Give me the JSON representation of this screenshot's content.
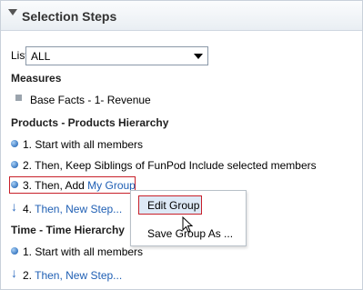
{
  "panel": {
    "title": "Selection Steps"
  },
  "list": {
    "label": "List",
    "value": "ALL"
  },
  "measures": {
    "heading": "Measures",
    "item": "Base Facts - 1- Revenue"
  },
  "products": {
    "heading": "Products - Products Hierarchy",
    "step1": "1. Start with all members",
    "step2": "2. Then, Keep Siblings of FunPod Include selected members",
    "step3_prefix": "3. Then, Add ",
    "step3_link": "My Group",
    "step4_prefix": "4. ",
    "step4_link": "Then, New Step..."
  },
  "time": {
    "heading": "Time - Time Hierarchy",
    "step1": "1. Start with all members",
    "step2_prefix": "2. ",
    "step2_link": "Then, New Step..."
  },
  "context_menu": {
    "edit_group": "Edit Group",
    "save_group_as": "Save Group As ..."
  },
  "colors": {
    "link": "#1f5fb4",
    "highlight_border": "#c8202a",
    "menu_hover": "#dde9f6"
  }
}
